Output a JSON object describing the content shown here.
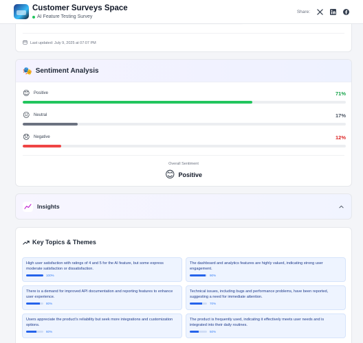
{
  "header": {
    "title": "Customer Surveys Space",
    "subtitle": "AI Feature Testing Survey",
    "share_label": "Share:",
    "icons": [
      "x-icon",
      "linkedin-icon",
      "facebook-icon"
    ]
  },
  "summary": {
    "last_updated": "Last updated: July 9, 2025 at 07:07 PM"
  },
  "sentiment": {
    "title": "Sentiment Analysis",
    "items": [
      {
        "label": "Positive",
        "percent_text": "71%",
        "value": 71,
        "color": "#16a34a",
        "bar_color": "#22c55e"
      },
      {
        "label": "Neutral",
        "percent_text": "17%",
        "value": 17,
        "color": "#4b5563",
        "bar_color": "#6b7280"
      },
      {
        "label": "Negative",
        "percent_text": "12%",
        "value": 12,
        "color": "#dc2626",
        "bar_color": "#ef4444"
      }
    ],
    "overall_label": "Overall Sentiment",
    "overall_value": "Positive"
  },
  "insights": {
    "title": "Insights",
    "expanded": false
  },
  "key_topics": {
    "title": "Key Topics & Themes",
    "items": [
      {
        "text": "High user satisfaction with ratings of 4 and 5 for the AI feature, but some express moderate satisfaction or dissatisfaction.",
        "percent_text": "100%",
        "value": 100
      },
      {
        "text": "The dashboard and analytics features are highly valued, indicating strong user engagement.",
        "percent_text": "90%",
        "value": 90
      },
      {
        "text": "There is a demand for improved API documentation and reporting features to enhance user experience.",
        "percent_text": "80%",
        "value": 80
      },
      {
        "text": "Technical issues, including bugs and performance problems, have been reported, suggesting a need for immediate attention.",
        "percent_text": "70%",
        "value": 70
      },
      {
        "text": "Users appreciate the product's reliability but seek more integrations and customization options.",
        "percent_text": "60%",
        "value": 60
      },
      {
        "text": "The product is frequently used, indicating it effectively meets user needs and is integrated into their daily routines.",
        "percent_text": "50%",
        "value": 50
      }
    ]
  },
  "colors": {
    "accent": "#2563eb",
    "positive": "#16a34a",
    "negative": "#dc2626"
  }
}
